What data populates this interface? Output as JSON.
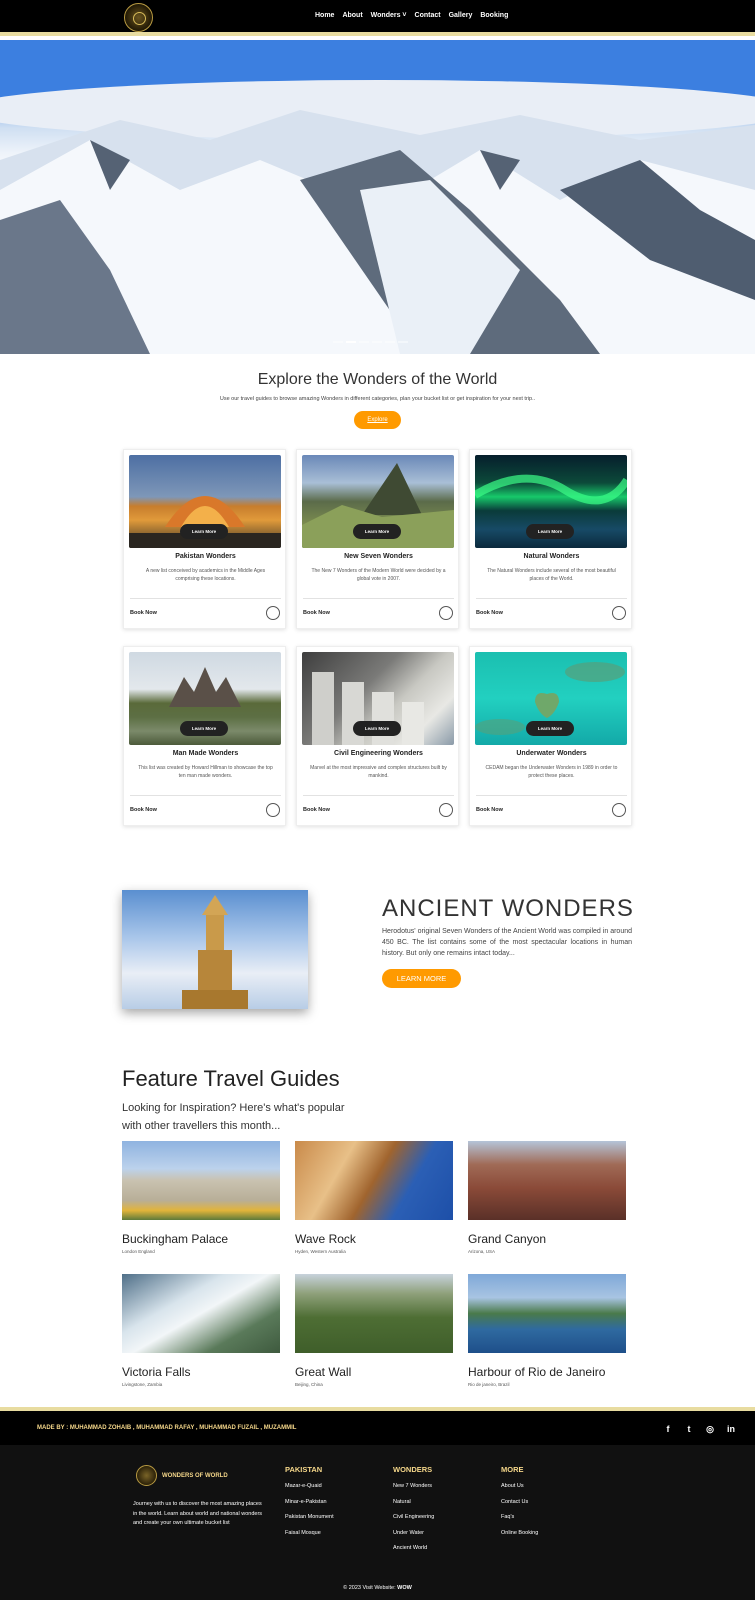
{
  "nav": {
    "items": [
      "Home",
      "About",
      "Wonders ˅",
      "Contact",
      "Gallery",
      "Booking"
    ]
  },
  "explore": {
    "title": "Explore the Wonders of the World",
    "subtitle": "Use our travel guides to browse amazing Wonders in different categories, plan your bucket list or get inspiration for your next trip..",
    "button": "Explore"
  },
  "cards": [
    {
      "title": "Pakistan Wonders",
      "desc": "A new list conceived by academics in the Middle Ages comprising these locations.",
      "learn": "Learn More",
      "book": "Book Now"
    },
    {
      "title": "New Seven Wonders",
      "desc": "The New 7 Wonders of the Modern World were decided by a global vote in 2007.",
      "learn": "Learn More",
      "book": "Book Now"
    },
    {
      "title": "Natural Wonders",
      "desc": "The Natural Wonders include several of the most beautiful places of the World.",
      "learn": "Learn More",
      "book": "Book Now"
    },
    {
      "title": "Man Made Wonders",
      "desc": "This list was created by Howard Hillman to showcase the top ten man made wonders.",
      "learn": "Learn More",
      "book": "Book Now"
    },
    {
      "title": "Civil Engineering Wonders",
      "desc": "Marvel at the most impressive and complex structures built by mankind.",
      "learn": "Learn More",
      "book": "Book Now"
    },
    {
      "title": "Underwater Wonders",
      "desc": "CEDAM began the Underwater Wonders in 1989 in order to protect these places.",
      "learn": "Learn More",
      "book": "Book Now"
    }
  ],
  "ancient": {
    "title": "ANCIENT WONDERS",
    "text": "Herodotus' original Seven Wonders of the Ancient World was compiled in around 450 BC. The list contains some of the most spectacular locations in human history. But only one remains intact today...",
    "button": "LEARN MORE"
  },
  "feature": {
    "title": "Feature Travel Guides",
    "subtitle": "Looking for Inspiration? Here's what's popular with other travellers this month...",
    "guides": [
      {
        "name": "Buckingham Palace",
        "loc": "London England"
      },
      {
        "name": "Wave Rock",
        "loc": "Hyden, Western Australia"
      },
      {
        "name": "Grand Canyon",
        "loc": "Arizona, USA"
      },
      {
        "name": "Victoria Falls",
        "loc": "Livingstone, Zambia"
      },
      {
        "name": "Great Wall",
        "loc": "Beijing, China"
      },
      {
        "name": "Harbour of Rio de Janeiro",
        "loc": "Rio de janeiro, Brazil"
      }
    ]
  },
  "footer": {
    "madeby": "MADE BY : MUHAMMAD ZOHAIB , MUHAMMAD RAFAY , MUHAMMAD FUZAIL , MUZAMMIL",
    "social": [
      "f",
      "t",
      "◎",
      "in"
    ],
    "brand": "WONDERS OF WORLD",
    "about": "Journey with us to discover the most amazing places in the world. Learn about world and national wonders and create your own ultimate bucket list",
    "cols": [
      {
        "title": "PAKISTAN",
        "links": [
          "Mazar-e-Quaid",
          "Minar-e-Pakistan",
          "Pakistan Monument",
          "Faisal Mosque"
        ]
      },
      {
        "title": "WONDERS",
        "links": [
          "New 7 Wonders",
          "Natural",
          "Civil Engineering",
          "Under Water",
          "Ancient World"
        ]
      },
      {
        "title": "MORE",
        "links": [
          "About Us",
          "Contact Us",
          "Faq's",
          "Online Booking"
        ]
      }
    ],
    "copyright": "© 2023 Visit Website:",
    "copyright_brand": "WOW"
  }
}
